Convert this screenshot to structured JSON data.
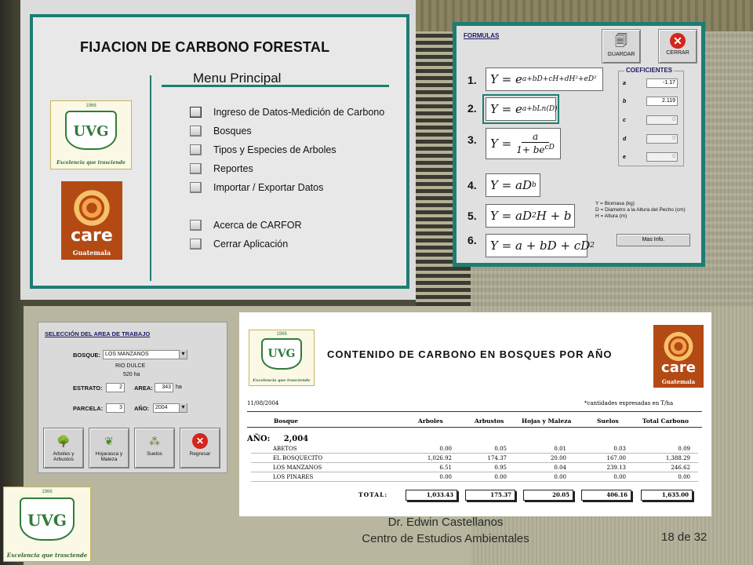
{
  "menu": {
    "title": "FIJACION DE CARBONO FORESTAL",
    "subtitle": "Menu Principal",
    "items": [
      "Ingreso de Datos-Medición de Carbono",
      "Bosques",
      "Tipos y Especies de Arboles",
      "Reportes",
      "Importar / Exportar Datos",
      "Acerca de CARFOR",
      "Cerrar Aplicación"
    ]
  },
  "logos": {
    "uvg_monogram": "UVG",
    "uvg_year": "1966",
    "uvg_motto": "Excelencia que trasciende",
    "care_word": "care",
    "care_sub": "Guatemala"
  },
  "formulas": {
    "label": "FORMULAS",
    "save_label": "GUARDAR",
    "close_label": "CERRAR",
    "coef_title": "COEFICIENTES",
    "numbers": [
      "1.",
      "2.",
      "3.",
      "4.",
      "5.",
      "6."
    ],
    "coefficients": [
      {
        "name": "a",
        "value": "-1.17"
      },
      {
        "name": "b",
        "value": "2.119"
      },
      {
        "name": "c",
        "value": "0"
      },
      {
        "name": "d",
        "value": "0"
      },
      {
        "name": "e",
        "value": "0"
      }
    ],
    "legend": [
      "Y = Biomasa (kg)",
      "D = Diametro a la Altura del Pecho (cm)",
      "H = Altura (m)"
    ],
    "more_info": "Mas Info."
  },
  "work": {
    "title": "SELECCIÓN DEL AREA DE TRABAJO",
    "bosque_label": "BOSQUE:",
    "bosque_value": "LOS MANZANOS",
    "location": "RIO DULCE",
    "location_area": "520 ha",
    "estrato_label": "ESTRATO:",
    "estrato_value": "2",
    "area_label": "AREA:",
    "area_value": "343",
    "area_unit": "ha",
    "parcela_label": "PARCELA:",
    "parcela_value": "3",
    "anio_label": "AÑO:",
    "anio_value": "2004",
    "buttons": [
      "Arboles y Arbustos",
      "Hojarasca y Maleza",
      "Suelos",
      "Regresar"
    ]
  },
  "report": {
    "title": "CONTENIDO DE CARBONO EN BOSQUES POR AÑO",
    "date": "11/08/2004",
    "note": "*cantidades expresadas en T/ha",
    "columns": [
      "Bosque",
      "Arboles",
      "Arbustos",
      "Hojas y Maleza",
      "Suelos",
      "Total Carbono"
    ],
    "year_label": "AÑO:",
    "year_value": "2,004",
    "rows": [
      [
        "ABETOS",
        "0.00",
        "0.05",
        "0.01",
        "0.03",
        "0.09"
      ],
      [
        "EL BOSQUECITO",
        "1,026.92",
        "174.37",
        "20.00",
        "167.00",
        "1,388.29"
      ],
      [
        "LOS MANZANOS",
        "6.51",
        "0.95",
        "0.04",
        "239.13",
        "246.62"
      ],
      [
        "LOS PINARES",
        "0.00",
        "0.00",
        "0.00",
        "0.00",
        "0.00"
      ]
    ],
    "total_label": "TOTAL:",
    "totals": [
      "1,033.43",
      "175.37",
      "20.05",
      "406.16",
      "1,635.00"
    ]
  },
  "footer": {
    "author": "Dr. Edwin Castellanos",
    "center": "Centro de Estudios Ambientales",
    "page": "18 de 32"
  }
}
